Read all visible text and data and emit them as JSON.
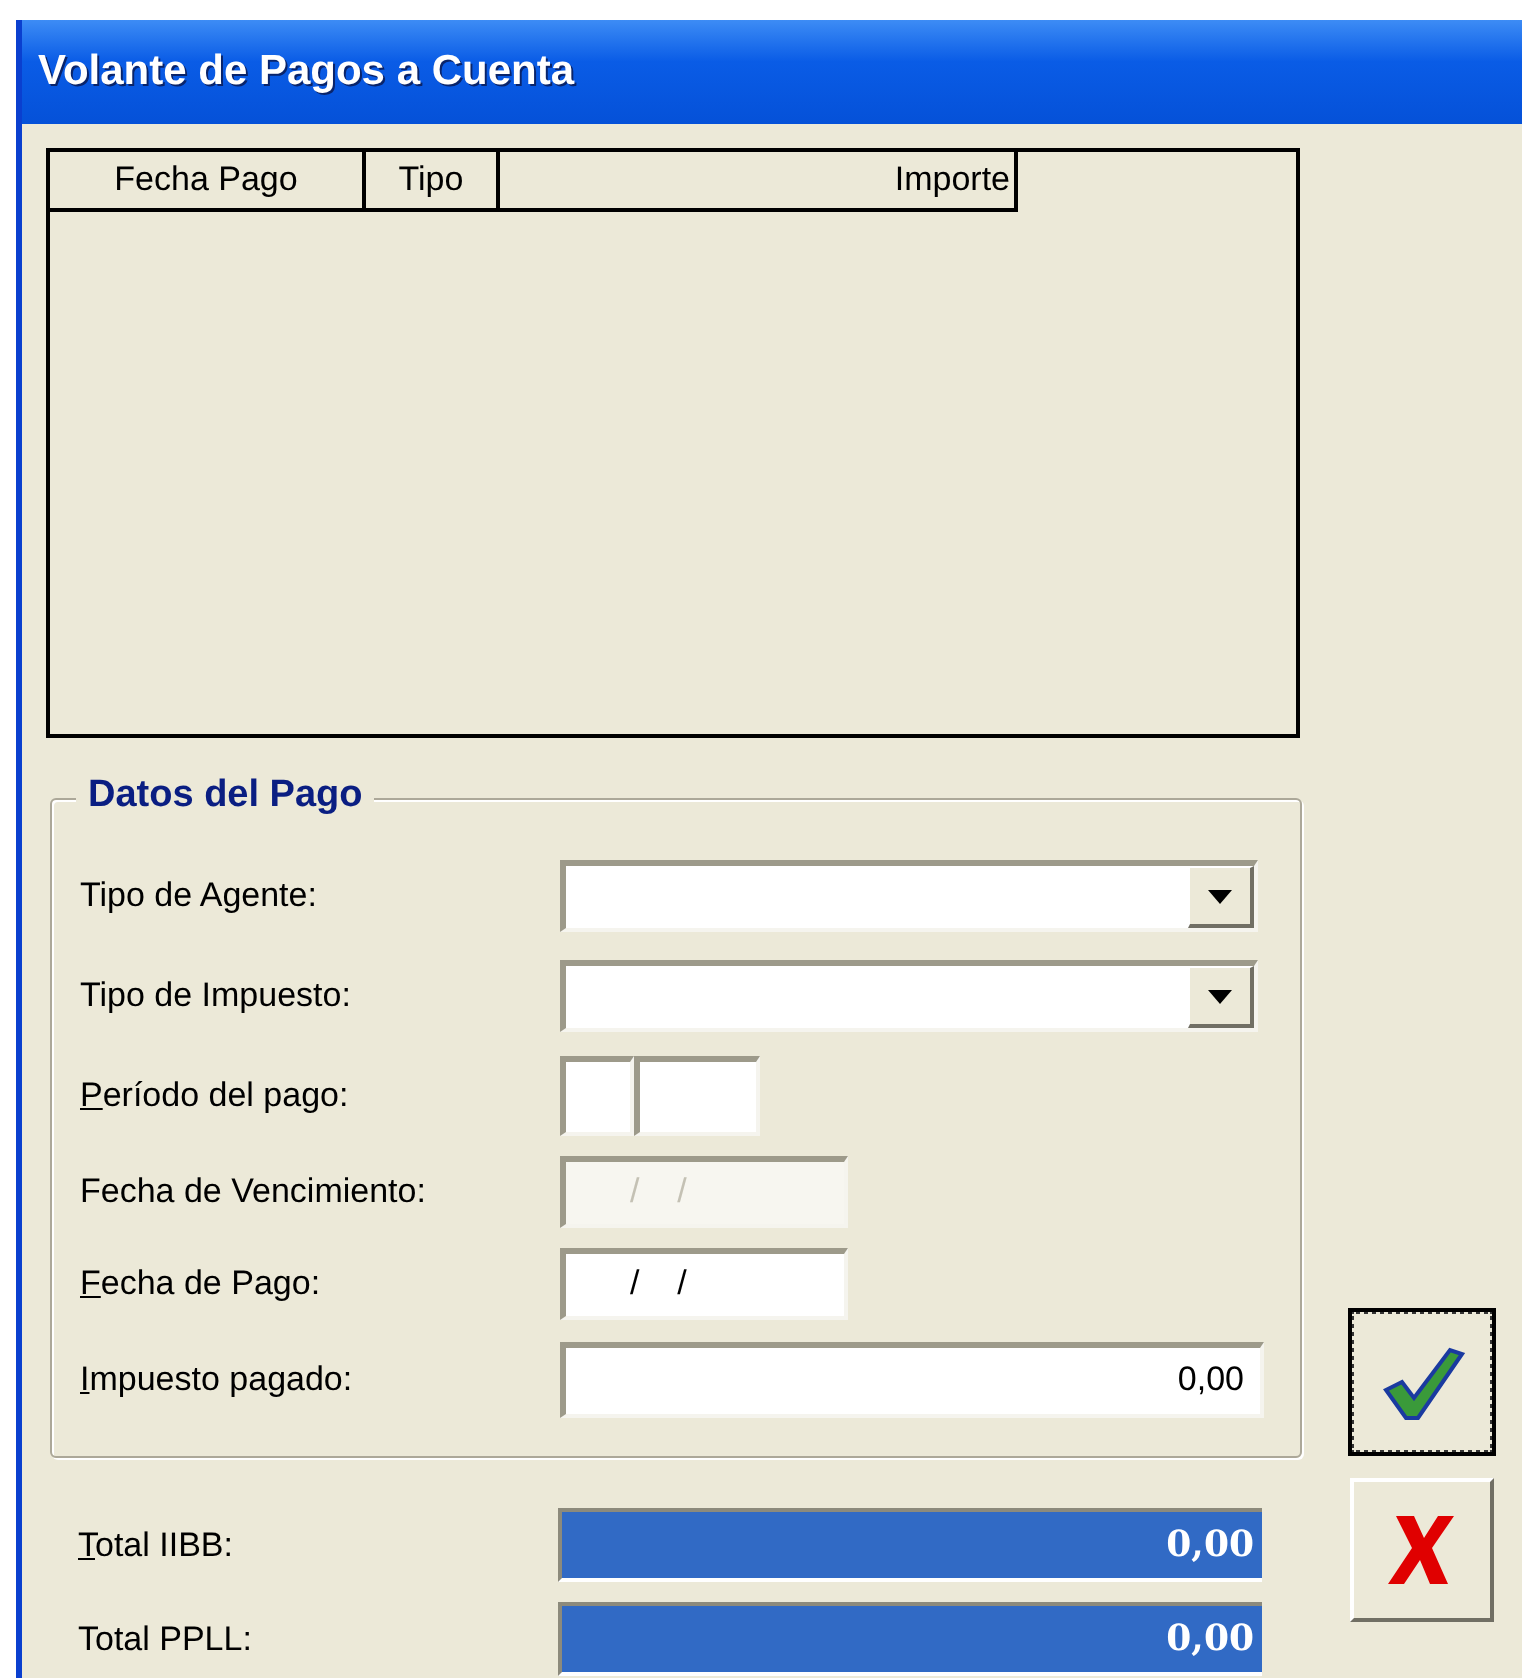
{
  "window": {
    "title": "Volante de Pagos a Cuenta"
  },
  "payments_list": {
    "columns": [
      "Fecha Pago",
      "Tipo",
      "Importe"
    ]
  },
  "payment_data": {
    "title": "Datos del Pago",
    "fields": [
      {
        "label": "Tipo de Agente:",
        "kind": "combo",
        "mnemonic": false
      },
      {
        "label": "Tipo de Impuesto:",
        "kind": "combo",
        "mnemonic": false
      },
      {
        "label": "Período del pago:",
        "kind": "period",
        "mnemonic": true
      },
      {
        "label": "Fecha de Vencimiento:",
        "kind": "date",
        "value": "/    /",
        "mnemonic": false,
        "disabled": true
      },
      {
        "label": "Fecha de Pago:",
        "kind": "date",
        "value": "/    /",
        "mnemonic": true,
        "disabled": false
      },
      {
        "label": "Impuesto pagado:",
        "kind": "number",
        "value": "0,00",
        "mnemonic": true
      }
    ]
  },
  "totals": [
    {
      "label": "Total IIBB:",
      "value": "0,00",
      "mnemonic": true
    },
    {
      "label": "Total PPLL:",
      "value": "0,00",
      "mnemonic": false
    }
  ],
  "buttons": [
    {
      "kind": "ok",
      "focused": true
    },
    {
      "kind": "cancel",
      "focused": false
    }
  ]
}
